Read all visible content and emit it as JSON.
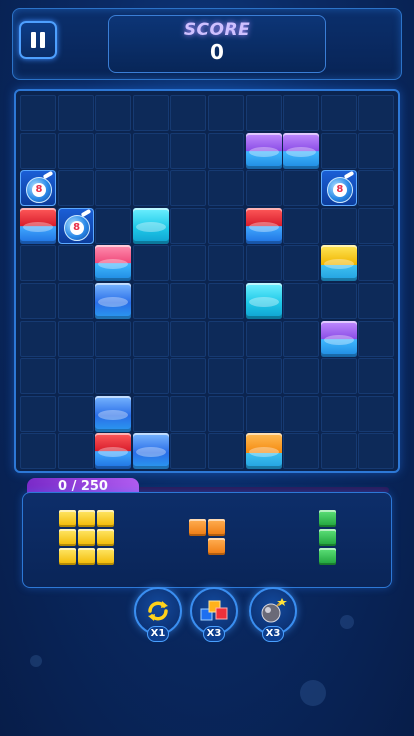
{
  "header": {
    "score_label": "SCORE",
    "score_value": "0",
    "pause_icon": "pause-icon"
  },
  "board": {
    "rows": 10,
    "cols": 10,
    "blocks": [
      {
        "row": 1,
        "col": 6,
        "color": "purple"
      },
      {
        "row": 1,
        "col": 7,
        "color": "purple"
      },
      {
        "row": 2,
        "col": 0,
        "type": "bomb",
        "label": "8"
      },
      {
        "row": 2,
        "col": 8,
        "type": "bomb",
        "label": "8"
      },
      {
        "row": 3,
        "col": 0,
        "color": "red"
      },
      {
        "row": 3,
        "col": 1,
        "type": "bomb",
        "label": "8"
      },
      {
        "row": 3,
        "col": 3,
        "color": "cyan"
      },
      {
        "row": 3,
        "col": 6,
        "color": "red"
      },
      {
        "row": 4,
        "col": 2,
        "color": "pink"
      },
      {
        "row": 4,
        "col": 8,
        "color": "yellow"
      },
      {
        "row": 5,
        "col": 2,
        "color": "blue"
      },
      {
        "row": 5,
        "col": 6,
        "color": "cyan"
      },
      {
        "row": 6,
        "col": 8,
        "color": "purple"
      },
      {
        "row": 8,
        "col": 2,
        "color": "blue"
      },
      {
        "row": 9,
        "col": 2,
        "color": "red"
      },
      {
        "row": 9,
        "col": 3,
        "color": "blue"
      },
      {
        "row": 9,
        "col": 6,
        "color": "orange"
      }
    ]
  },
  "progress": {
    "text": "0 / 250",
    "current": 0,
    "target": 250
  },
  "pieces": [
    {
      "name": "yellow-square-3x3",
      "color": "yellow",
      "cells": [
        [
          0,
          0
        ],
        [
          0,
          1
        ],
        [
          0,
          2
        ],
        [
          1,
          0
        ],
        [
          1,
          1
        ],
        [
          1,
          2
        ],
        [
          2,
          0
        ],
        [
          2,
          1
        ],
        [
          2,
          2
        ]
      ]
    },
    {
      "name": "orange-l-piece",
      "color": "orange",
      "cells": [
        [
          0,
          0
        ],
        [
          0,
          1
        ],
        [
          1,
          1
        ]
      ]
    },
    {
      "name": "green-i-piece",
      "color": "green",
      "cells": [
        [
          0,
          0
        ],
        [
          1,
          0
        ],
        [
          2,
          0
        ]
      ]
    }
  ],
  "powerups": [
    {
      "name": "refresh",
      "icon": "refresh-icon",
      "count": "X1"
    },
    {
      "name": "blocks",
      "icon": "blocks-icon",
      "count": "X3"
    },
    {
      "name": "bomb",
      "icon": "bomb-icon",
      "count": "X3"
    }
  ]
}
